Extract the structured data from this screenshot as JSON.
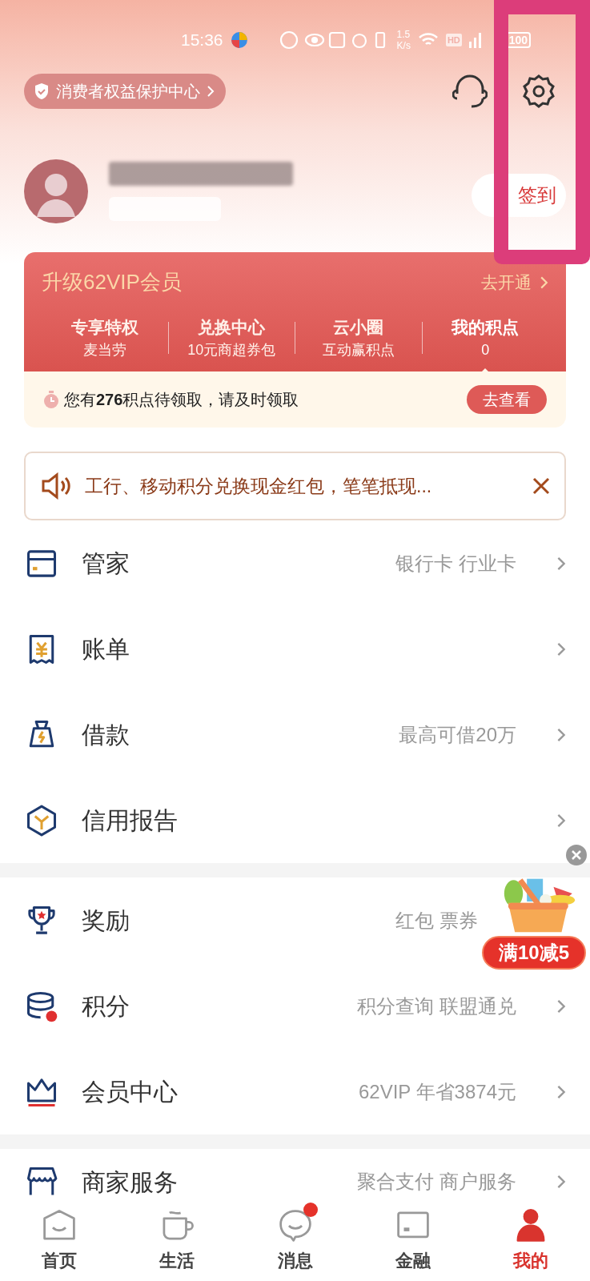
{
  "status_bar": {
    "time": "15:36",
    "speed_value": "1.5",
    "speed_unit": "K/s",
    "network": "HD",
    "battery": "100"
  },
  "consumer_badge": {
    "label": "消费者权益保护中心"
  },
  "profile": {
    "sign_in_button": "签到"
  },
  "vip_card": {
    "title": "升级62VIP会员",
    "action": "去开通",
    "perks": [
      {
        "title": "专享特权",
        "subtitle": "麦当劳",
        "selected": false
      },
      {
        "title": "兑换中心",
        "subtitle": "10元商超券包",
        "selected": false
      },
      {
        "title": "云小圈",
        "subtitle": "互动赢积点",
        "selected": false
      },
      {
        "title": "我的积点",
        "subtitle": "0",
        "selected": true
      }
    ],
    "reminder": {
      "text": "您有**276**积点待领取，请及时领取",
      "button": "去查看"
    }
  },
  "notice": {
    "text": "工行、移动积分兑换现金红包，笔笔抵现..."
  },
  "menu_groups": [
    [
      {
        "label": "管家",
        "detail": "银行卡 行业卡",
        "chevron": true
      },
      {
        "label": "账单",
        "chevron": true
      },
      {
        "label": "借款",
        "detail": "最高可借20万",
        "chevron": true
      },
      {
        "label": "信用报告",
        "chevron": true
      }
    ],
    [
      {
        "label": "奖励",
        "detail": "红包 票券",
        "chevron": false
      },
      {
        "label": "积分",
        "detail": "积分查询 联盟通兑",
        "chevron": true
      },
      {
        "label": "会员中心",
        "detail": "62VIP 年省3874元",
        "chevron": true
      }
    ],
    [
      {
        "label": "商家服务",
        "detail": "聚合支付 商户服务",
        "chevron": true
      }
    ]
  ],
  "promo": {
    "label": "满10减5"
  },
  "tab_bar": [
    {
      "label": "首页",
      "selected": false,
      "badge": false
    },
    {
      "label": "生活",
      "selected": false,
      "badge": false
    },
    {
      "label": "消息",
      "selected": false,
      "badge": true
    },
    {
      "label": "金融",
      "selected": false,
      "badge": false
    },
    {
      "label": "我的",
      "selected": true,
      "badge": false
    }
  ]
}
